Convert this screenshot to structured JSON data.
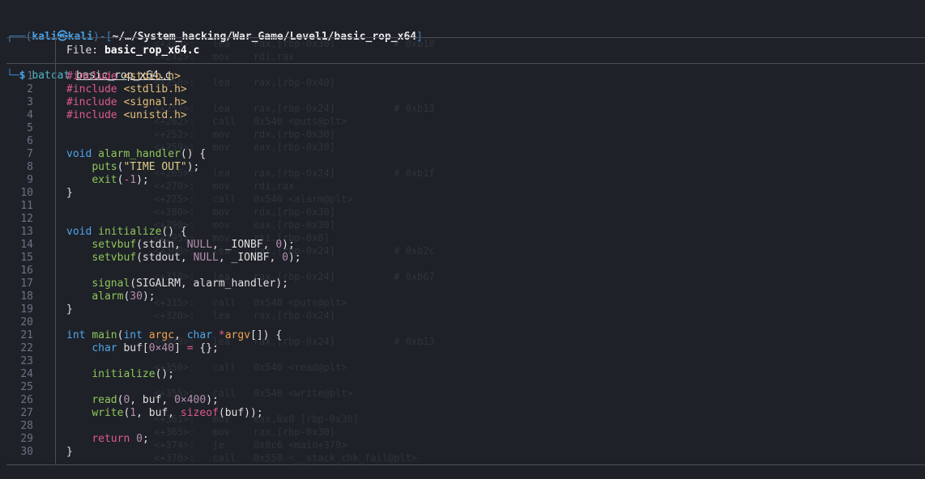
{
  "prompt": {
    "user": "kali",
    "host": "kali",
    "path": "~/…/System_hacking/War_Game/Level1/basic_rop_x64",
    "command": "batcat",
    "argument": "basic_rop_x64.c"
  },
  "file_header": {
    "label": "File: ",
    "name": "basic_rop_x64.c"
  },
  "code_lines": [
    [
      {
        "t": "#include ",
        "c": "pp"
      },
      {
        "t": "<stdio.h>",
        "c": "inc"
      }
    ],
    [
      {
        "t": "#include ",
        "c": "pp"
      },
      {
        "t": "<stdlib.h>",
        "c": "inc"
      }
    ],
    [
      {
        "t": "#include ",
        "c": "pp"
      },
      {
        "t": "<signal.h>",
        "c": "inc"
      }
    ],
    [
      {
        "t": "#include ",
        "c": "pp"
      },
      {
        "t": "<unistd.h>",
        "c": "inc"
      }
    ],
    [],
    [],
    [
      {
        "t": "void ",
        "c": "kw"
      },
      {
        "t": "alarm_handler",
        "c": "fn"
      },
      {
        "t": "() {",
        "c": "plain"
      }
    ],
    [
      {
        "t": "    ",
        "c": "plain"
      },
      {
        "t": "puts",
        "c": "fn"
      },
      {
        "t": "(",
        "c": "plain"
      },
      {
        "t": "\"TIME OUT\"",
        "c": "str"
      },
      {
        "t": ");",
        "c": "plain"
      }
    ],
    [
      {
        "t": "    ",
        "c": "plain"
      },
      {
        "t": "exit",
        "c": "fn"
      },
      {
        "t": "(",
        "c": "plain"
      },
      {
        "t": "-",
        "c": "op"
      },
      {
        "t": "1",
        "c": "num"
      },
      {
        "t": ");",
        "c": "plain"
      }
    ],
    [
      {
        "t": "}",
        "c": "plain"
      }
    ],
    [],
    [],
    [
      {
        "t": "void ",
        "c": "kw"
      },
      {
        "t": "initialize",
        "c": "fn"
      },
      {
        "t": "() {",
        "c": "plain"
      }
    ],
    [
      {
        "t": "    ",
        "c": "plain"
      },
      {
        "t": "setvbuf",
        "c": "fn"
      },
      {
        "t": "(stdin, ",
        "c": "plain"
      },
      {
        "t": "NULL",
        "c": "cst"
      },
      {
        "t": ", _IONBF, ",
        "c": "plain"
      },
      {
        "t": "0",
        "c": "num"
      },
      {
        "t": ");",
        "c": "plain"
      }
    ],
    [
      {
        "t": "    ",
        "c": "plain"
      },
      {
        "t": "setvbuf",
        "c": "fn"
      },
      {
        "t": "(stdout, ",
        "c": "plain"
      },
      {
        "t": "NULL",
        "c": "cst"
      },
      {
        "t": ", _IONBF, ",
        "c": "plain"
      },
      {
        "t": "0",
        "c": "num"
      },
      {
        "t": ");",
        "c": "plain"
      }
    ],
    [],
    [
      {
        "t": "    ",
        "c": "plain"
      },
      {
        "t": "signal",
        "c": "fn"
      },
      {
        "t": "(SIGALRM, alarm_handler);",
        "c": "plain"
      }
    ],
    [
      {
        "t": "    ",
        "c": "plain"
      },
      {
        "t": "alarm",
        "c": "fn"
      },
      {
        "t": "(",
        "c": "plain"
      },
      {
        "t": "30",
        "c": "num"
      },
      {
        "t": ");",
        "c": "plain"
      }
    ],
    [
      {
        "t": "}",
        "c": "plain"
      }
    ],
    [],
    [
      {
        "t": "int ",
        "c": "kw"
      },
      {
        "t": "main",
        "c": "fn"
      },
      {
        "t": "(",
        "c": "plain"
      },
      {
        "t": "int ",
        "c": "kw"
      },
      {
        "t": "argc",
        "c": "arg"
      },
      {
        "t": ", ",
        "c": "plain"
      },
      {
        "t": "char ",
        "c": "kw"
      },
      {
        "t": "*",
        "c": "op"
      },
      {
        "t": "argv",
        "c": "arg"
      },
      {
        "t": "[]) {",
        "c": "plain"
      }
    ],
    [
      {
        "t": "    ",
        "c": "plain"
      },
      {
        "t": "char ",
        "c": "kw"
      },
      {
        "t": "buf[",
        "c": "plain"
      },
      {
        "t": "0×40",
        "c": "num"
      },
      {
        "t": "] ",
        "c": "plain"
      },
      {
        "t": "=",
        "c": "op"
      },
      {
        "t": " {};",
        "c": "plain"
      }
    ],
    [],
    [
      {
        "t": "    ",
        "c": "plain"
      },
      {
        "t": "initialize",
        "c": "fn"
      },
      {
        "t": "();",
        "c": "plain"
      }
    ],
    [],
    [
      {
        "t": "    ",
        "c": "plain"
      },
      {
        "t": "read",
        "c": "fn"
      },
      {
        "t": "(",
        "c": "plain"
      },
      {
        "t": "0",
        "c": "num"
      },
      {
        "t": ", buf, ",
        "c": "plain"
      },
      {
        "t": "0×400",
        "c": "num"
      },
      {
        "t": ");",
        "c": "plain"
      }
    ],
    [
      {
        "t": "    ",
        "c": "plain"
      },
      {
        "t": "write",
        "c": "fn"
      },
      {
        "t": "(",
        "c": "plain"
      },
      {
        "t": "1",
        "c": "num"
      },
      {
        "t": ", buf, ",
        "c": "plain"
      },
      {
        "t": "sizeof",
        "c": "ret"
      },
      {
        "t": "(buf));",
        "c": "plain"
      }
    ],
    [],
    [
      {
        "t": "    ",
        "c": "plain"
      },
      {
        "t": "return ",
        "c": "ret"
      },
      {
        "t": "0",
        "c": "num"
      },
      {
        "t": ";",
        "c": "plain"
      }
    ],
    [
      {
        "t": "}",
        "c": "plain"
      }
    ]
  ]
}
